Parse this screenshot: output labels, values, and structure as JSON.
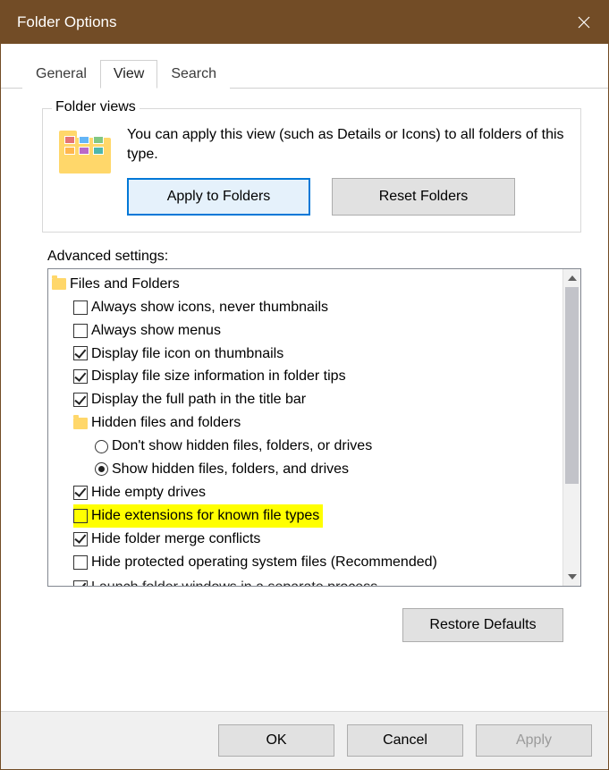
{
  "window": {
    "title": "Folder Options"
  },
  "tabs": {
    "general": "General",
    "view": "View",
    "search": "Search",
    "active": "view"
  },
  "folder_views": {
    "groupTitle": "Folder views",
    "description": "You can apply this view (such as Details or Icons) to all folders of this type.",
    "applyBtn": "Apply to Folders",
    "resetBtn": "Reset Folders"
  },
  "advanced": {
    "label": "Advanced settings:",
    "rootLabel": "Files and Folders",
    "hiddenGroupLabel": "Hidden files and folders",
    "items": {
      "alwaysIcons": {
        "label": "Always show icons, never thumbnails",
        "checked": false
      },
      "alwaysMenus": {
        "label": "Always show menus",
        "checked": false
      },
      "displayIcon": {
        "label": "Display file icon on thumbnails",
        "checked": true
      },
      "displaySize": {
        "label": "Display file size information in folder tips",
        "checked": true
      },
      "displayPath": {
        "label": "Display the full path in the title bar",
        "checked": true
      },
      "radioDontShow": {
        "label": "Don't show hidden files, folders, or drives",
        "checked": false
      },
      "radioShow": {
        "label": "Show hidden files, folders, and drives",
        "checked": true
      },
      "hideEmpty": {
        "label": "Hide empty drives",
        "checked": true
      },
      "hideExt": {
        "label": "Hide extensions for known file types",
        "checked": false,
        "highlighted": true
      },
      "hideMerge": {
        "label": "Hide folder merge conflicts",
        "checked": true
      },
      "hideProtected": {
        "label": "Hide protected operating system files (Recommended)",
        "checked": false
      },
      "launchSeparate": {
        "label": "Launch folder windows in a separate process",
        "checked": true
      }
    }
  },
  "buttons": {
    "restore": "Restore Defaults",
    "ok": "OK",
    "cancel": "Cancel",
    "apply": "Apply"
  }
}
